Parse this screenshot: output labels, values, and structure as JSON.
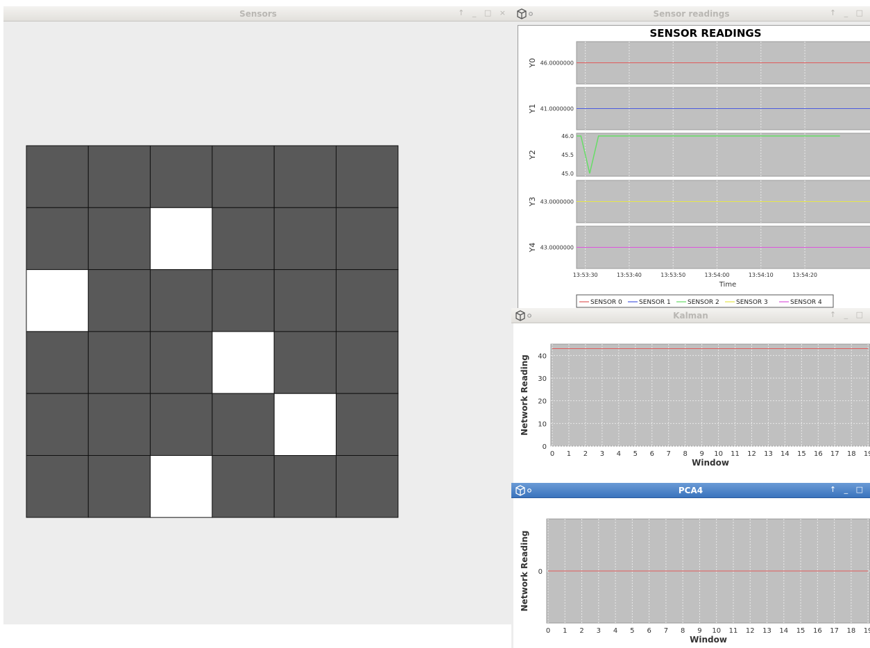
{
  "windows": {
    "sensors": {
      "title": "Sensors",
      "controls": "↑ _ □ ×"
    },
    "readings": {
      "title": "Sensor readings",
      "controls": "↑ _ □"
    },
    "kalman": {
      "title": "Kalman",
      "controls": "↑ _ □"
    },
    "pca": {
      "title": "PCA4",
      "controls": "↑ _ □"
    }
  },
  "sensor_grid": {
    "rows": 6,
    "cols": 6,
    "off_color": "#595959",
    "on_color": "#ffffff",
    "active_cells": [
      [
        1,
        2
      ],
      [
        2,
        0
      ],
      [
        3,
        3
      ],
      [
        4,
        4
      ],
      [
        5,
        2
      ]
    ]
  },
  "chart_data": [
    {
      "type": "line",
      "title": "SENSOR READINGS",
      "xlabel": "Time",
      "x_ticks": [
        "13:53:30",
        "13:53:40",
        "13:53:50",
        "13:54:00",
        "13:54:10",
        "13:54:20"
      ],
      "series": [
        {
          "name": "SENSOR 0",
          "axis": "Y0",
          "color": "#e05a5a",
          "tick_label": "46.0000000",
          "values": [
            46,
            46,
            46,
            46,
            46,
            46
          ]
        },
        {
          "name": "SENSOR 1",
          "axis": "Y1",
          "color": "#4a5adf",
          "tick_label": "41.0000000",
          "values": [
            41,
            41,
            41,
            41,
            41,
            41
          ]
        },
        {
          "name": "SENSOR 2",
          "axis": "Y2",
          "color": "#66dd66",
          "ticks": [
            "46.0",
            "45.5",
            "45.0"
          ],
          "ylim": [
            45,
            46
          ],
          "values_detail": [
            [
              "13:53:30",
              46
            ],
            [
              "13:53:31",
              46
            ],
            [
              "13:53:33",
              45
            ],
            [
              "13:53:35",
              46
            ],
            [
              "13:54:30",
              46
            ]
          ]
        },
        {
          "name": "SENSOR 3",
          "axis": "Y3",
          "color": "#e6e64a",
          "tick_label": "43.0000000",
          "values": [
            43,
            43,
            43,
            43,
            43,
            43
          ]
        },
        {
          "name": "SENSOR 4",
          "axis": "Y4",
          "color": "#dd55dd",
          "tick_label": "43.0000000",
          "values": [
            43,
            43,
            43,
            43,
            43,
            43
          ]
        }
      ],
      "legend_position": "bottom"
    },
    {
      "type": "line",
      "title": "",
      "xlabel": "Window",
      "ylabel": "Network Reading",
      "x": [
        0,
        1,
        2,
        3,
        4,
        5,
        6,
        7,
        8,
        9,
        10,
        11,
        12,
        13,
        14,
        15,
        16,
        17,
        18,
        19
      ],
      "y_ticks": [
        "0",
        "10",
        "20",
        "30",
        "40"
      ],
      "ylim": [
        0,
        45
      ],
      "series": [
        {
          "color": "#e05a5a",
          "values": [
            43,
            43,
            43,
            43,
            43,
            43,
            43,
            43,
            43,
            43,
            43,
            43,
            43,
            43,
            43,
            43,
            43,
            43,
            43,
            43
          ]
        }
      ]
    },
    {
      "type": "line",
      "title": "",
      "xlabel": "Window",
      "ylabel": "Network Reading",
      "x": [
        0,
        1,
        2,
        3,
        4,
        5,
        6,
        7,
        8,
        9,
        10,
        11,
        12,
        13,
        14,
        15,
        16,
        17,
        18,
        19
      ],
      "y_ticks": [
        "0"
      ],
      "ylim": [
        -1,
        1
      ],
      "series": [
        {
          "color": "#e05a5a",
          "values": [
            0,
            0,
            0,
            0,
            0,
            0,
            0,
            0,
            0,
            0,
            0,
            0,
            0,
            0,
            0,
            0,
            0,
            0,
            0,
            0
          ]
        }
      ]
    }
  ]
}
